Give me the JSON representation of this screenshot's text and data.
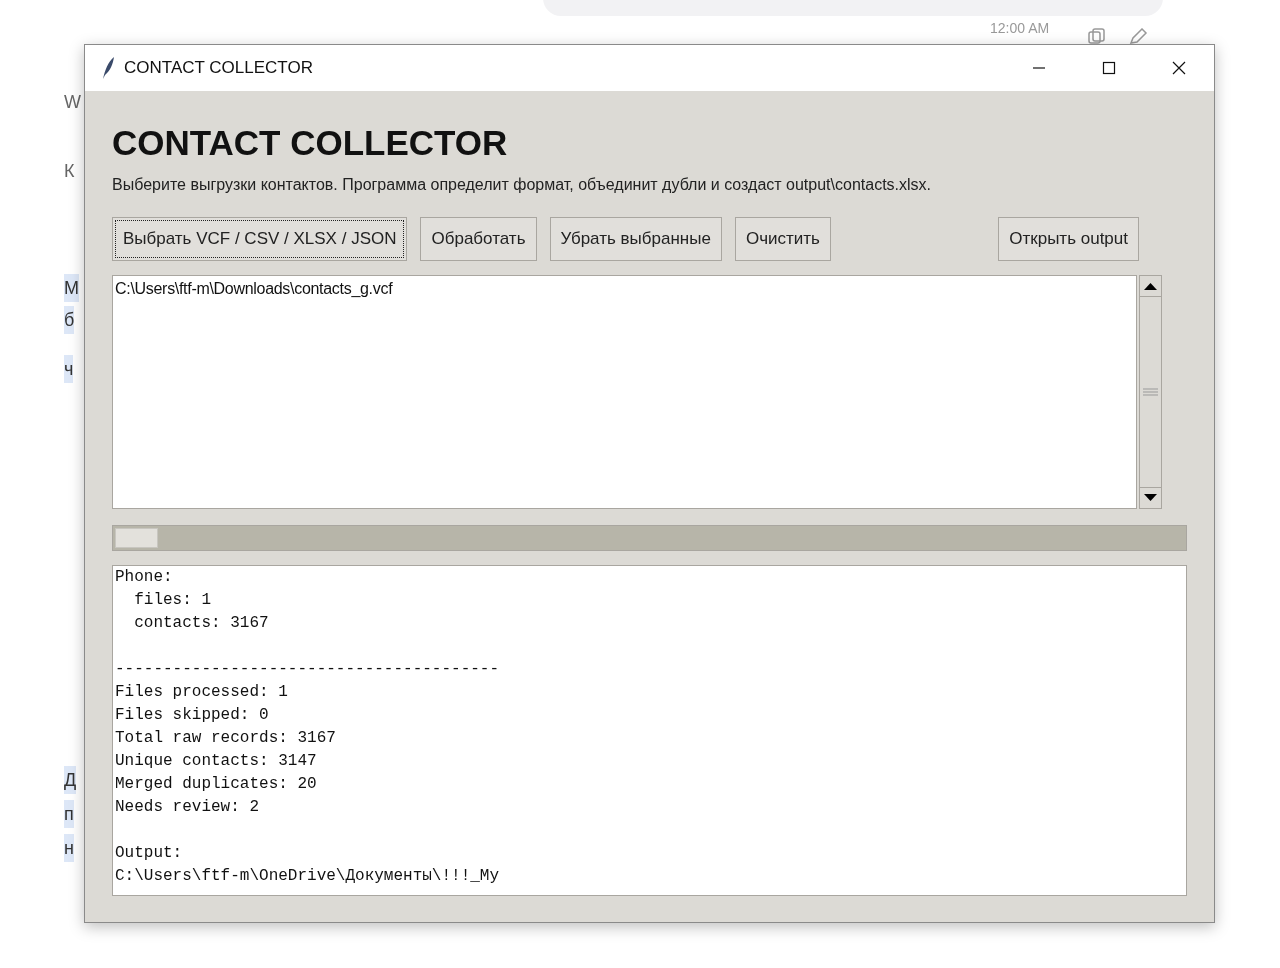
{
  "background_chat": {
    "time": "12:00 AM",
    "fragments": [
      {
        "text": "W",
        "highlighted": false
      },
      {
        "text": "К",
        "highlighted": false
      },
      {
        "text": "М",
        "highlighted": true
      },
      {
        "text": "б",
        "highlighted": true
      },
      {
        "text": "ч",
        "highlighted": true
      },
      {
        "text": "Д",
        "highlighted": true
      },
      {
        "text": "п",
        "highlighted": true
      },
      {
        "text": "н",
        "highlighted": true
      }
    ]
  },
  "window": {
    "title": "CONTACT COLLECTOR"
  },
  "heading": "CONTACT COLLECTOR",
  "description": "Выберите выгрузки контактов. Программа определит формат, объединит дубли и создаст output\\contacts.xlsx.",
  "buttons": [
    {
      "label": "Выбрать VCF / CSV / XLSX / JSON",
      "focused": true
    },
    {
      "label": "Обработать",
      "focused": false
    },
    {
      "label": "Убрать выбранные",
      "focused": false
    },
    {
      "label": "Очистить",
      "focused": false
    },
    {
      "label": "Открыть output",
      "focused": false,
      "kind": "right"
    }
  ],
  "file_list": [
    {
      "path": "C:\\Users\\ftf-m\\Downloads\\contacts_g.vcf",
      "selected": false
    }
  ],
  "progress": {
    "level": 0.04
  },
  "log_blocks": [
    {
      "lines": [
        "Phone:",
        "  files: 1",
        "  contacts: 3167"
      ]
    },
    {
      "lines": [
        "----------------------------------------",
        "Files processed: 1",
        "Files skipped: 0",
        "Total raw records: 3167",
        "Unique contacts: 3147",
        "Merged duplicates: 20",
        "Needs review: 2"
      ]
    },
    {
      "lines": [
        "Output:",
        "C:\\Users\\ftf-m\\OneDrive\\Документы\\!!!_My"
      ]
    }
  ]
}
